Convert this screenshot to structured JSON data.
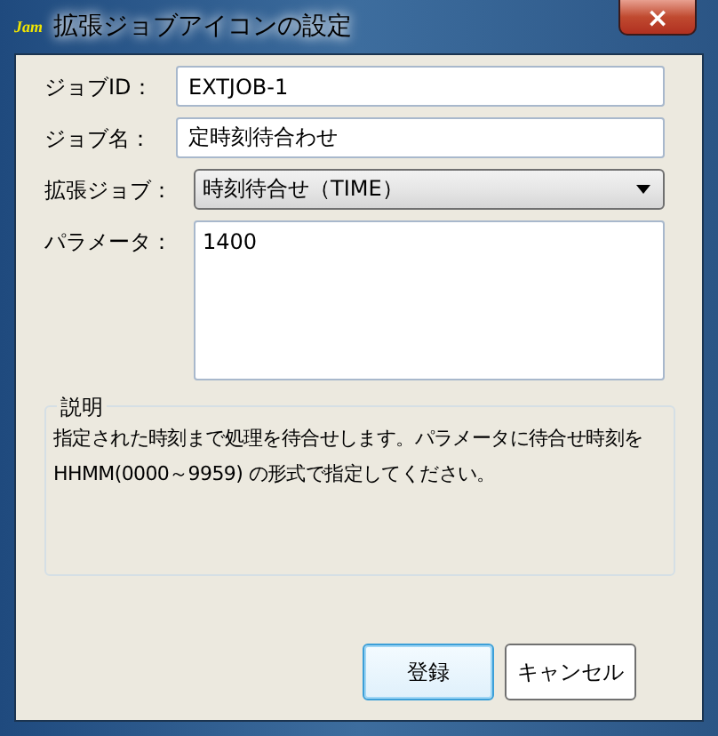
{
  "window": {
    "title": "拡張ジョブアイコンの設定",
    "app_badge": "Jam",
    "close": "×"
  },
  "fields": [
    {
      "kind": "text",
      "label": "ジョブID：",
      "value": "EXTJOB-1"
    },
    {
      "kind": "text",
      "label": "ジョブ名：",
      "value": "定時刻待合わせ"
    },
    {
      "kind": "select",
      "label": "拡張ジョブ：",
      "value": "時刻待合せ（TIME）"
    },
    {
      "kind": "textarea",
      "label": "パラメータ：",
      "value": "1400"
    }
  ],
  "description": {
    "title": "説明",
    "text": "指定された時刻まで処理を待合せします。パラメータに待合せ時刻を\nHHMM(0000～9959) の形式で指定してください。"
  },
  "buttons": [
    {
      "label": "登録",
      "default": true
    },
    {
      "label": "キャンセル",
      "default": false
    }
  ]
}
